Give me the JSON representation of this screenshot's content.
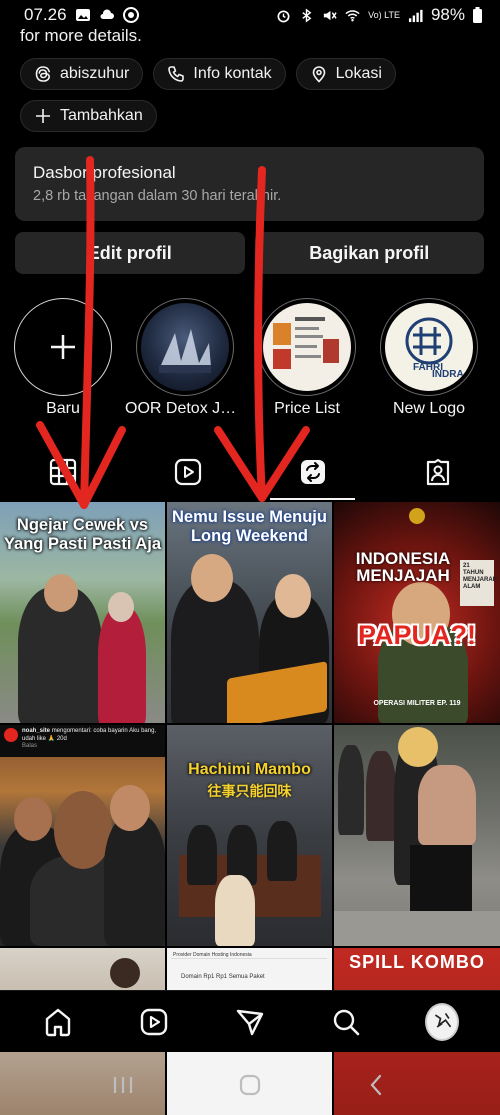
{
  "status": {
    "time": "07.26",
    "battery": "98%",
    "network": "Vo) LTE"
  },
  "bio": {
    "text": "for more details."
  },
  "pills": [
    {
      "label": "abiszuhur",
      "icon": "threads-icon"
    },
    {
      "label": "Info kontak",
      "icon": "phone-icon"
    },
    {
      "label": "Lokasi",
      "icon": "location-pin-icon"
    },
    {
      "label": "Tambahkan",
      "icon": "plus-icon"
    }
  ],
  "dashboard": {
    "title": "Dasbor profesional",
    "subtitle": "2,8 rb tayangan dalam 30 hari terakhir."
  },
  "actions": {
    "edit": "Edit profil",
    "share": "Bagikan profil"
  },
  "highlights": [
    {
      "label": "Baru"
    },
    {
      "label": "OOR Detox JKT..."
    },
    {
      "label": "Price List"
    },
    {
      "label": "New Logo"
    }
  ],
  "highlight_logo": {
    "line1": "FAHRI",
    "line2": "INDRA"
  },
  "posts": [
    {
      "caption": "Ngejar Cewek vs Yang Pasti Pasti Aja"
    },
    {
      "caption": "Nemu Issue Menuju Long Weekend"
    },
    {
      "caption_top": "INDONESIA MENJAJAH",
      "caption_mid": "PAPUA?!",
      "small": "OPERASI MILITER EP. 119",
      "side": "21 TAHUN MENJARAH ALAM"
    },
    {
      "comment_user": "noah_site",
      "comment_text": "mengomentari: coba bayarin Aku bang, udah like 🙏 20d",
      "reply": "Balas"
    },
    {
      "caption": "Hachimi Mambo",
      "sub": "往事只能回味"
    },
    {
      "caption": ""
    },
    {
      "caption": ""
    },
    {
      "header": "Provider Domain Hosting Indonesia",
      "line": "Domain Rp1 Rp1 Semua Paket"
    },
    {
      "caption": "SPILL KOMBO"
    }
  ],
  "colors": {
    "accent_red": "#e3261f",
    "bg": "#000000",
    "card": "#262626",
    "text_muted": "#a8a8a8"
  }
}
